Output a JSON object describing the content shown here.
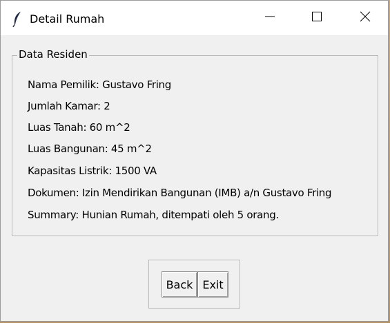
{
  "window": {
    "title": "Detail Rumah",
    "icon": "feather-icon",
    "controls": [
      "minimize-icon",
      "maximize-icon",
      "close-icon"
    ]
  },
  "group": {
    "legend": "Data Residen",
    "lines": [
      "Nama Pemilik: Gustavo Fring",
      "Jumlah Kamar: 2",
      "Luas Tanah: 60 m^2",
      "Luas Bangunan: 45 m^2",
      "Kapasitas Listrik: 1500 VA",
      "Dokumen: Izin Mendirikan Bangunan (IMB) a/n Gustavo Fring",
      "Summary: Hunian Rumah, ditempati oleh 5 orang."
    ]
  },
  "buttons": {
    "back_label": "Back",
    "exit_label": "Exit"
  }
}
